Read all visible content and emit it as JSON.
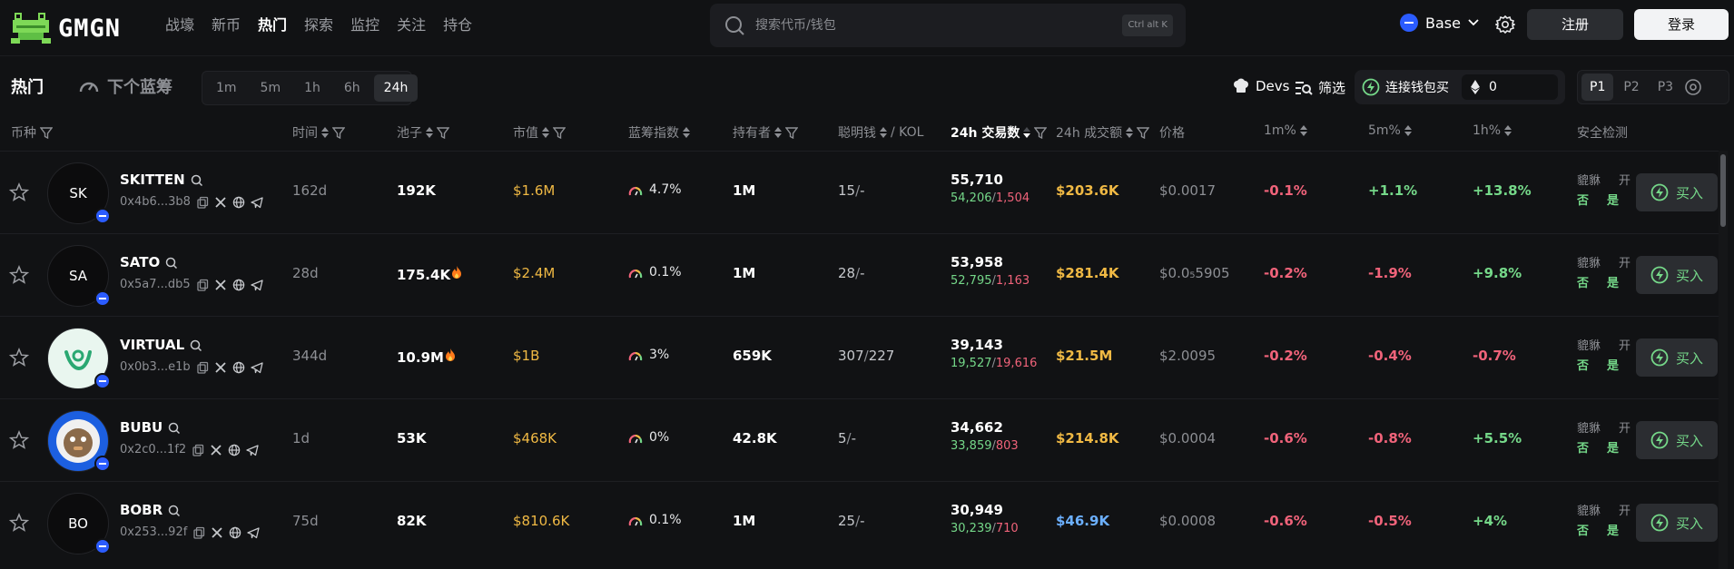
{
  "brand": {
    "name": "GMGN"
  },
  "nav": {
    "items": [
      "战壕",
      "新币",
      "热门",
      "探索",
      "监控",
      "关注",
      "持仓"
    ],
    "active": 2
  },
  "search": {
    "placeholder": "搜索代币/钱包",
    "shortcut": "Ctrl alt K"
  },
  "chain": {
    "label": "Base",
    "color": "#2b5cff"
  },
  "auth": {
    "register": "注册",
    "login": "登录"
  },
  "toolbar": {
    "hot": "热门",
    "next_blue": "下个蓝筹",
    "timeframes": [
      "1m",
      "5m",
      "1h",
      "6h",
      "24h"
    ],
    "active_timeframe": "24h",
    "devs": "Devs",
    "filter": "筛选",
    "connect_wallet": "连接钱包买",
    "wallet_amount": "0",
    "pages": [
      "P1",
      "P2",
      "P3"
    ],
    "active_page": "P1"
  },
  "columns": {
    "token": "币种",
    "age": "时间",
    "pool": "池子",
    "mcap": "市值",
    "blue_index": "蓝筹指数",
    "holders": "持有者",
    "smart": "聪明钱",
    "smart_sep": "/ KOL",
    "tx": "24h 交易数",
    "volume": "24h 成交额",
    "price": "价格",
    "m1": "1m%",
    "m5": "5m%",
    "h1": "1h%",
    "security": "安全检测"
  },
  "security_labels": {
    "a": "貔貅",
    "b": "开"
  },
  "buy_label": "买入",
  "rows": [
    {
      "symbol": "SKITTEN",
      "avatar_text": "SK",
      "avatar_style": "dark",
      "address": "0x4b6...3b8",
      "age": "162d",
      "pool": "192K",
      "pool_fire": false,
      "mcap": "$1.6M",
      "blue_index": "4.7%",
      "holders": "1M",
      "smart": "15",
      "kol": "-",
      "tx_total": "55,710",
      "tx_buy": "54,206",
      "tx_sell": "1,504",
      "volume": "$203.6K",
      "volume_color": "#f0b944",
      "price": "$0.0017",
      "m1": "-0.1%",
      "m5": "+1.1%",
      "h1": "+13.8%",
      "sec_a": "否",
      "sec_b": "是"
    },
    {
      "symbol": "SATO",
      "avatar_text": "SA",
      "avatar_style": "dark",
      "address": "0x5a7...db5",
      "age": "28d",
      "pool": "175.4K",
      "pool_fire": true,
      "mcap": "$2.4M",
      "blue_index": "0.1%",
      "holders": "1M",
      "smart": "28",
      "kol": "-",
      "tx_total": "53,958",
      "tx_buy": "52,795",
      "tx_sell": "1,163",
      "volume": "$281.4K",
      "volume_color": "#f0b944",
      "price": "$0.0₅5905",
      "m1": "-0.2%",
      "m5": "-1.9%",
      "h1": "+9.8%",
      "sec_a": "否",
      "sec_b": "是"
    },
    {
      "symbol": "VIRTUAL",
      "avatar_text": "",
      "avatar_style": "virtual",
      "address": "0x0b3...e1b",
      "age": "344d",
      "pool": "10.9M",
      "pool_fire": true,
      "mcap": "$1B",
      "blue_index": "3%",
      "holders": "659K",
      "smart": "307",
      "kol": "227",
      "tx_total": "39,143",
      "tx_buy": "19,527",
      "tx_sell": "19,616",
      "volume": "$21.5M",
      "volume_color": "#f0b944",
      "price": "$2.0095",
      "m1": "-0.2%",
      "m5": "-0.4%",
      "h1": "-0.7%",
      "sec_a": "否",
      "sec_b": "是"
    },
    {
      "symbol": "BUBU",
      "avatar_text": "",
      "avatar_style": "bubu",
      "address": "0x2c0...1f2",
      "age": "1d",
      "pool": "53K",
      "pool_fire": false,
      "mcap": "$468K",
      "blue_index": "0%",
      "holders": "42.8K",
      "smart": "5",
      "kol": "-",
      "tx_total": "34,662",
      "tx_buy": "33,859",
      "tx_sell": "803",
      "volume": "$214.8K",
      "volume_color": "#f0b944",
      "price": "$0.0004",
      "m1": "-0.6%",
      "m5": "-0.8%",
      "h1": "+5.5%",
      "sec_a": "否",
      "sec_b": "是"
    },
    {
      "symbol": "BOBR",
      "avatar_text": "BO",
      "avatar_style": "dark",
      "address": "0x253...92f",
      "age": "75d",
      "pool": "82K",
      "pool_fire": false,
      "mcap": "$810.6K",
      "blue_index": "0.1%",
      "holders": "1M",
      "smart": "25",
      "kol": "-",
      "tx_total": "30,949",
      "tx_buy": "30,239",
      "tx_sell": "710",
      "volume": "$46.9K",
      "volume_color": "#6cb0ff",
      "price": "$0.0008",
      "m1": "-0.6%",
      "m5": "-0.5%",
      "h1": "+4%",
      "sec_a": "否",
      "sec_b": "是"
    }
  ]
}
